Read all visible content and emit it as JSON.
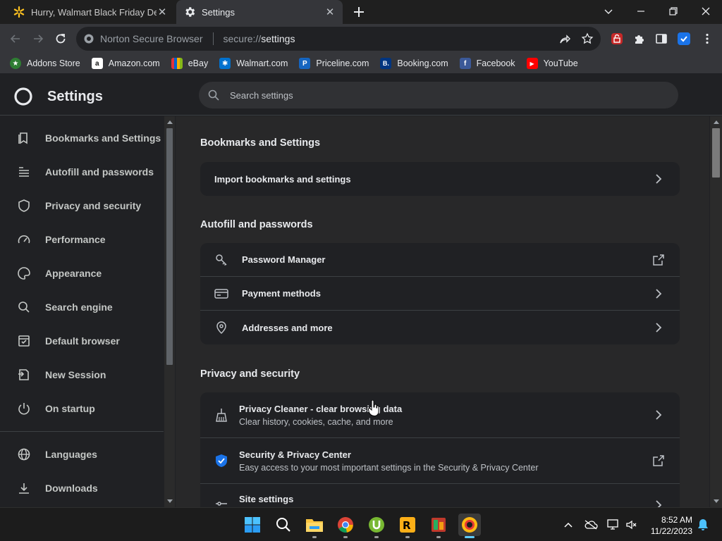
{
  "tabs": [
    {
      "title": "Hurry, Walmart Black Friday Dea",
      "active": false,
      "icon": "walmart-spark-icon"
    },
    {
      "title": "Settings",
      "active": true,
      "icon": "gear-icon"
    }
  ],
  "toolbar": {
    "omnibox_brand": "Norton Secure Browser",
    "url_scheme": "secure://",
    "url_host": "settings"
  },
  "bookmarks": [
    {
      "label": "Addons Store",
      "icon": "addons-store-icon",
      "color": "#2e7d32",
      "glyph": "A"
    },
    {
      "label": "Amazon.com",
      "icon": "amazon-icon",
      "color": "#ffffff",
      "glyph": "a"
    },
    {
      "label": "eBay",
      "icon": "ebay-icon",
      "color": "#e53238",
      "glyph": "e"
    },
    {
      "label": "Walmart.com",
      "icon": "walmart-icon",
      "color": "#0071ce",
      "glyph": "✱"
    },
    {
      "label": "Priceline.com",
      "icon": "priceline-icon",
      "color": "#1565c0",
      "glyph": "P"
    },
    {
      "label": "Booking.com",
      "icon": "booking-icon",
      "color": "#003580",
      "glyph": "B."
    },
    {
      "label": "Facebook",
      "icon": "facebook-icon",
      "color": "#3b5998",
      "glyph": "f"
    },
    {
      "label": "YouTube",
      "icon": "youtube-icon",
      "color": "#ff0000",
      "glyph": "▶"
    }
  ],
  "settings": {
    "title": "Settings",
    "search_placeholder": "Search settings"
  },
  "sidebar": {
    "items": [
      {
        "label": "Bookmarks and Settings",
        "icon": "bookmarks-icon"
      },
      {
        "label": "Autofill and passwords",
        "icon": "autofill-list-icon"
      },
      {
        "label": "Privacy and security",
        "icon": "shield-icon"
      },
      {
        "label": "Performance",
        "icon": "speedometer-icon"
      },
      {
        "label": "Appearance",
        "icon": "palette-icon"
      },
      {
        "label": "Search engine",
        "icon": "search-icon"
      },
      {
        "label": "Default browser",
        "icon": "browser-window-icon"
      },
      {
        "label": "New Session",
        "icon": "new-session-icon"
      },
      {
        "label": "On startup",
        "icon": "power-icon"
      },
      {
        "label": "Languages",
        "icon": "globe-icon"
      },
      {
        "label": "Downloads",
        "icon": "download-icon"
      }
    ]
  },
  "main": {
    "sections": [
      {
        "title": "Bookmarks and Settings",
        "rows": [
          {
            "label": "Import bookmarks and settings",
            "end": "chevron-right-icon"
          }
        ]
      },
      {
        "title": "Autofill and passwords",
        "rows": [
          {
            "label": "Password Manager",
            "icon": "key-icon",
            "end": "external-link-icon"
          },
          {
            "label": "Payment methods",
            "icon": "credit-card-icon",
            "end": "chevron-right-icon"
          },
          {
            "label": "Addresses and more",
            "icon": "location-pin-icon",
            "end": "chevron-right-icon"
          }
        ]
      },
      {
        "title": "Privacy and security",
        "rows": [
          {
            "label": "Privacy Cleaner - clear browsing data",
            "sub": "Clear history, cookies, cache, and more",
            "icon": "broom-icon",
            "end": "chevron-right-icon"
          },
          {
            "label": "Security & Privacy Center",
            "sub": "Easy access to your most important settings in the Security & Privacy Center",
            "icon": "shield-check-icon",
            "end": "external-link-icon"
          },
          {
            "label": "Site settings",
            "icon": "sliders-icon",
            "end": "chevron-right-icon"
          }
        ]
      }
    ]
  },
  "taskbar": {
    "time": "8:52 AM",
    "date": "11/22/2023"
  },
  "colors": {
    "accent_blue": "#1a73e8",
    "norton_yellow": "#fdb913"
  }
}
